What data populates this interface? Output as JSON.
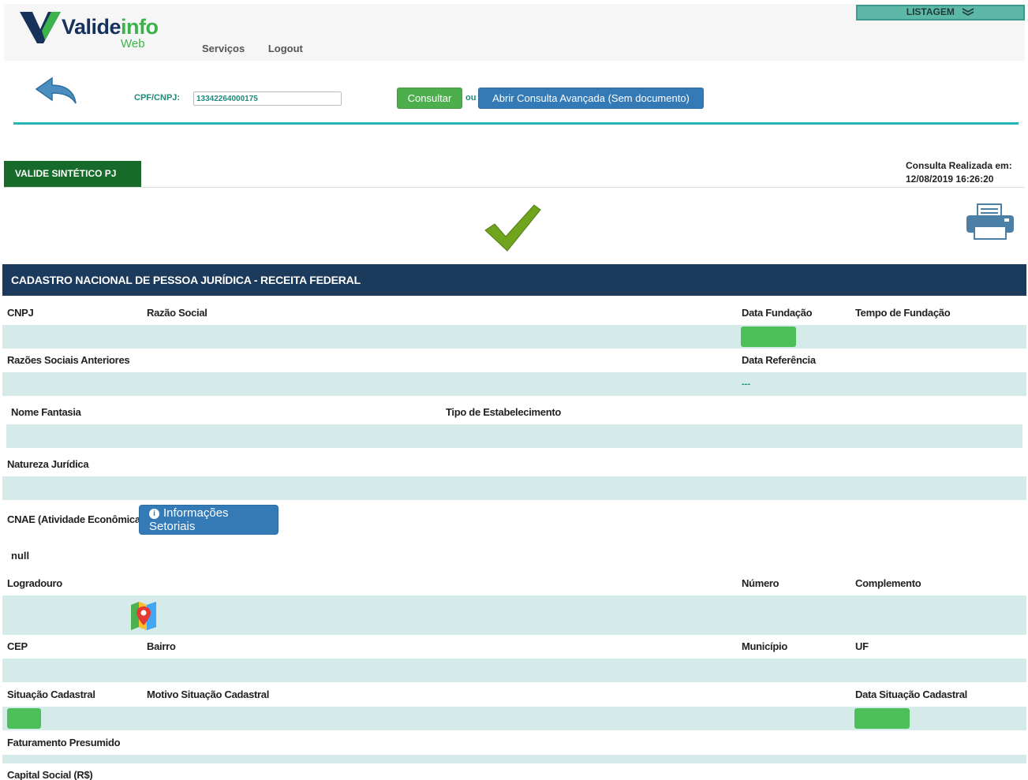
{
  "header": {
    "logo_name_part1": "Valide",
    "logo_name_part2": "info",
    "logo_sub": "Web",
    "nav": [
      "Serviços",
      "Logout"
    ],
    "listagem_label": "LISTAGEM"
  },
  "search": {
    "label": "CPF/CNPJ:",
    "value": "13342264000175",
    "consultar_label": "Consultar",
    "ou_label": "ou",
    "avancada_label": "Abrir Consulta Avançada (Sem documento)"
  },
  "tab": {
    "label": "VALIDE SINTÉTICO PJ"
  },
  "consulta": {
    "label": "Consulta Realizada em:",
    "datetime": "12/08/2019 16:26:20"
  },
  "cadastro": {
    "title": "CADASTRO NACIONAL DE PESSOA JURÍDICA - RECEITA FEDERAL",
    "labels": {
      "cnpj": "CNPJ",
      "razao_social": "Razão Social",
      "data_fundacao": "Data Fundação",
      "tempo_fundacao": "Tempo de Fundação",
      "razoes_anteriores": "Razões Sociais Anteriores",
      "data_referencia": "Data Referência",
      "nome_fantasia": "Nome Fantasia",
      "tipo_estabelecimento": "Tipo de Estabelecimento",
      "natureza_juridica": "Natureza Jurídica",
      "cnae": "CNAE (Atividade Econômica)",
      "logradouro": "Logradouro",
      "numero": "Número",
      "complemento": "Complemento",
      "cep": "CEP",
      "bairro": "Bairro",
      "municipio": "Município",
      "uf": "UF",
      "situacao_cadastral": "Situação Cadastral",
      "motivo_situacao": "Motivo Situação Cadastral",
      "data_situacao": "Data Situação Cadastral",
      "faturamento": "Faturamento Presumido",
      "capital_social": "Capital Social (R$)"
    },
    "data_referencia_value": "---",
    "cnae_value": "null",
    "info_button_label": "Informações Setoriais",
    "info_icon_glyph": "i"
  },
  "colors": {
    "navy": "#1b3a5c",
    "teal": "#25b5b5",
    "green": "#4cbf5a",
    "band": "#d4ebea",
    "blue_button": "#337ab7"
  },
  "icons": [
    "logo-v-icon",
    "chevron-down-icon",
    "back-arrow-icon",
    "checkmark-icon",
    "printer-icon",
    "info-icon",
    "map-pin-icon"
  ]
}
